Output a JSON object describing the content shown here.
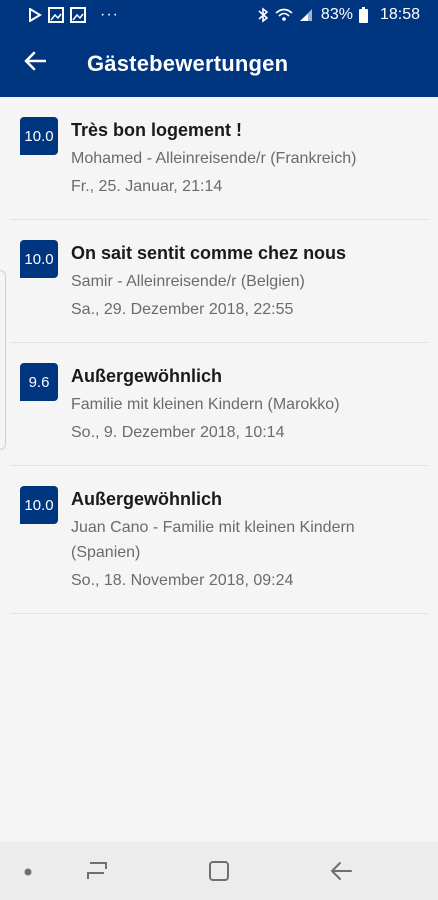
{
  "status_bar": {
    "battery": "83%",
    "time": "18:58",
    "dots": "···"
  },
  "app_bar": {
    "title": "Gästebewertungen"
  },
  "reviews": [
    {
      "score": "10.0",
      "title": "Très bon logement !",
      "author": "Mohamed - Alleinreisende/r (Frankreich)",
      "date": "Fr., 25. Januar, 21:14"
    },
    {
      "score": "10.0",
      "title": "On sait sentit comme chez nous",
      "author": "Samir - Alleinreisende/r (Belgien)",
      "date": "Sa., 29. Dezember 2018, 22:55"
    },
    {
      "score": "9.6",
      "title": "Außergewöhnlich",
      "author": "Familie mit kleinen Kindern (Marokko)",
      "date": "So., 9. Dezember 2018, 10:14"
    },
    {
      "score": "10.0",
      "title": "Außergewöhnlich",
      "author": "Juan Cano - Familie mit kleinen Kindern (Spanien)",
      "date": "So., 18. November 2018, 09:24"
    }
  ],
  "colors": {
    "brand": "#003580",
    "background": "#f5f5f5",
    "text_secondary": "#6b6b6b"
  },
  "icons": {
    "back": "arrow-left-icon",
    "nav_dot": "dot-icon",
    "nav_recent": "recent-apps-icon",
    "nav_home": "home-icon",
    "nav_back": "back-icon"
  }
}
